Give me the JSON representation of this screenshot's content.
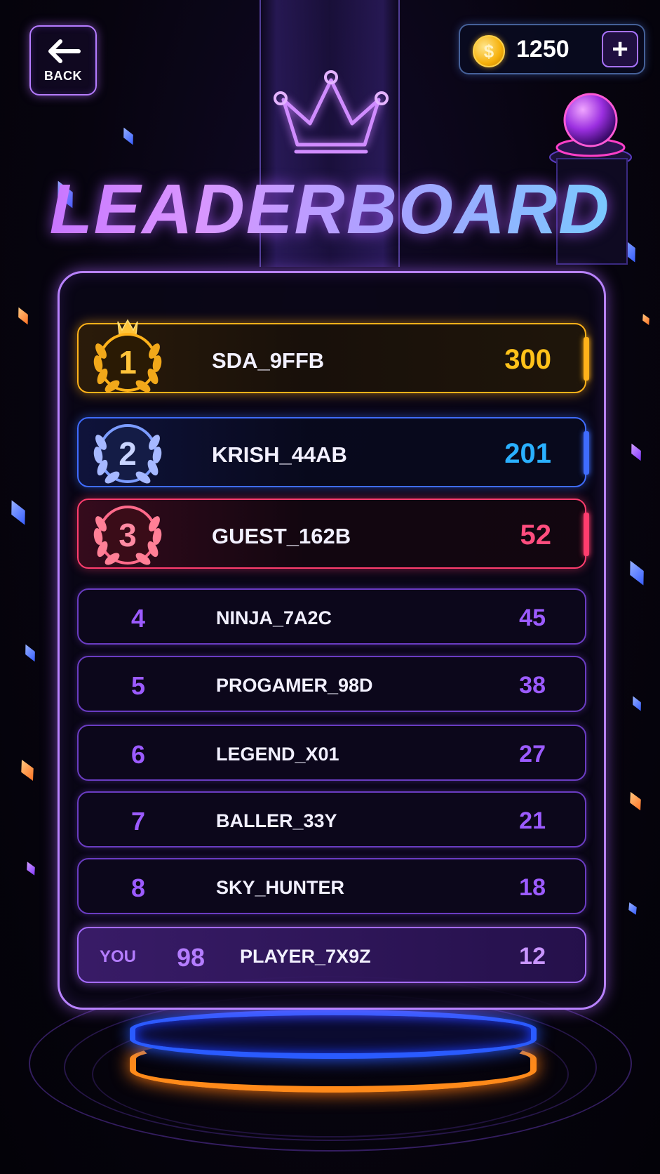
{
  "header": {
    "back_label": "BACK",
    "coins": "1250",
    "coin_symbol": "$",
    "add_coins_label": "+",
    "title": "LEADERBOARD"
  },
  "top_entries": [
    {
      "rank": "1",
      "name": "SDA_9FFB",
      "score": "300",
      "medal": "gold"
    },
    {
      "rank": "2",
      "name": "KRISH_44AB",
      "score": "201",
      "medal": "silver"
    },
    {
      "rank": "3",
      "name": "GUEST_162B",
      "score": "52",
      "medal": "bronze"
    }
  ],
  "entries": [
    {
      "rank": "4",
      "name": "NINJA_7A2C",
      "score": "45"
    },
    {
      "rank": "5",
      "name": "PROGAMER_98D",
      "score": "38"
    },
    {
      "rank": "6",
      "name": "LEGEND_X01",
      "score": "27"
    },
    {
      "rank": "7",
      "name": "BALLER_33Y",
      "score": "21"
    },
    {
      "rank": "8",
      "name": "SKY_HUNTER",
      "score": "18"
    }
  ],
  "you": {
    "label": "YOU",
    "rank": "98",
    "name": "PLAYER_7X9Z",
    "score": "12"
  },
  "colors": {
    "gold": "#ffb21a",
    "silver": "#3f6cff",
    "bronze": "#ff3d6e",
    "accent": "#9c5bff"
  },
  "icons": [
    "back-arrow-icon",
    "coin-icon",
    "plus-icon",
    "crown-icon",
    "laurel-medal-icon",
    "orb-icon"
  ]
}
